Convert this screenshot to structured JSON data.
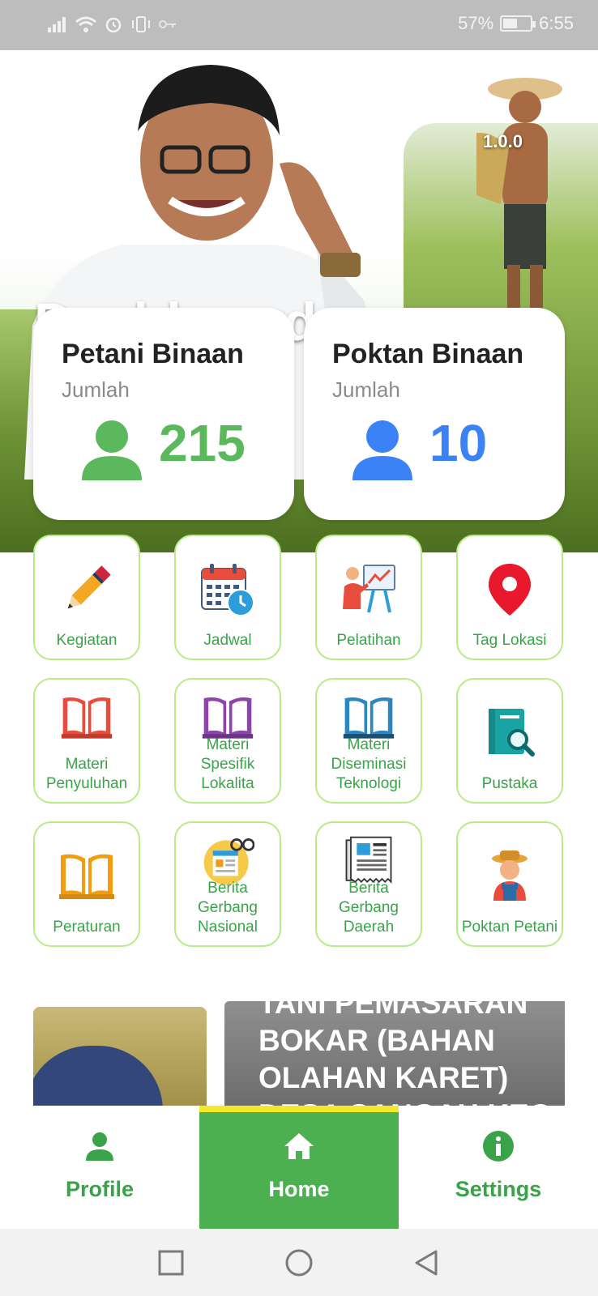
{
  "status_bar": {
    "battery_percent": "57%",
    "time": "6:55",
    "battery_level": 0.57,
    "icons": [
      "signal-icon",
      "wifi-icon",
      "alarm-icon",
      "vibrate-icon",
      "key-icon",
      "battery-icon"
    ]
  },
  "header": {
    "version": "1.0.0",
    "title": "Dashboard"
  },
  "stats": [
    {
      "title": "Petani Binaan",
      "subtitle": "Jumlah",
      "value": "215",
      "color": "#5cb85c",
      "icon": "user-icon"
    },
    {
      "title": "Poktan Binaan",
      "subtitle": "Jumlah",
      "value": "10",
      "color": "#3b82f6",
      "icon": "user-icon"
    }
  ],
  "menu": [
    {
      "label": "Kegiatan",
      "icon": "pencil-icon"
    },
    {
      "label": "Jadwal",
      "icon": "calendar-icon"
    },
    {
      "label": "Pelatihan",
      "icon": "presentation-icon"
    },
    {
      "label": "Tag Lokasi",
      "icon": "location-pin-icon"
    },
    {
      "label": "Materi Penyuluhan",
      "icon": "red-book-icon"
    },
    {
      "label": "Materi Spesifik Lokalita",
      "icon": "purple-book-icon"
    },
    {
      "label": "Materi Diseminasi Teknologi",
      "icon": "blue-book-icon"
    },
    {
      "label": "Pustaka",
      "icon": "library-search-icon"
    },
    {
      "label": "Peraturan",
      "icon": "orange-book-icon"
    },
    {
      "label": "Berita Gerbang Nasional",
      "icon": "news-glasses-icon"
    },
    {
      "label": "Berita Gerbang Daerah",
      "icon": "newspaper-icon"
    },
    {
      "label": "Poktan Petani",
      "icon": "farmer-icon"
    }
  ],
  "news": {
    "headline": "TANI PEMASARAN BOKAR (BAHAN OLAHAN KARET) DESA SANGAH KEC"
  },
  "bottom_nav": [
    {
      "label": "Profile",
      "icon": "person-icon"
    },
    {
      "label": "Home",
      "icon": "home-icon",
      "active": true
    },
    {
      "label": "Settings",
      "icon": "info-icon"
    }
  ],
  "colors": {
    "primary_green": "#4caf50",
    "accent_yellow": "#f2e82c",
    "card_border": "#b7ec86",
    "label_green": "#3aa34a"
  }
}
